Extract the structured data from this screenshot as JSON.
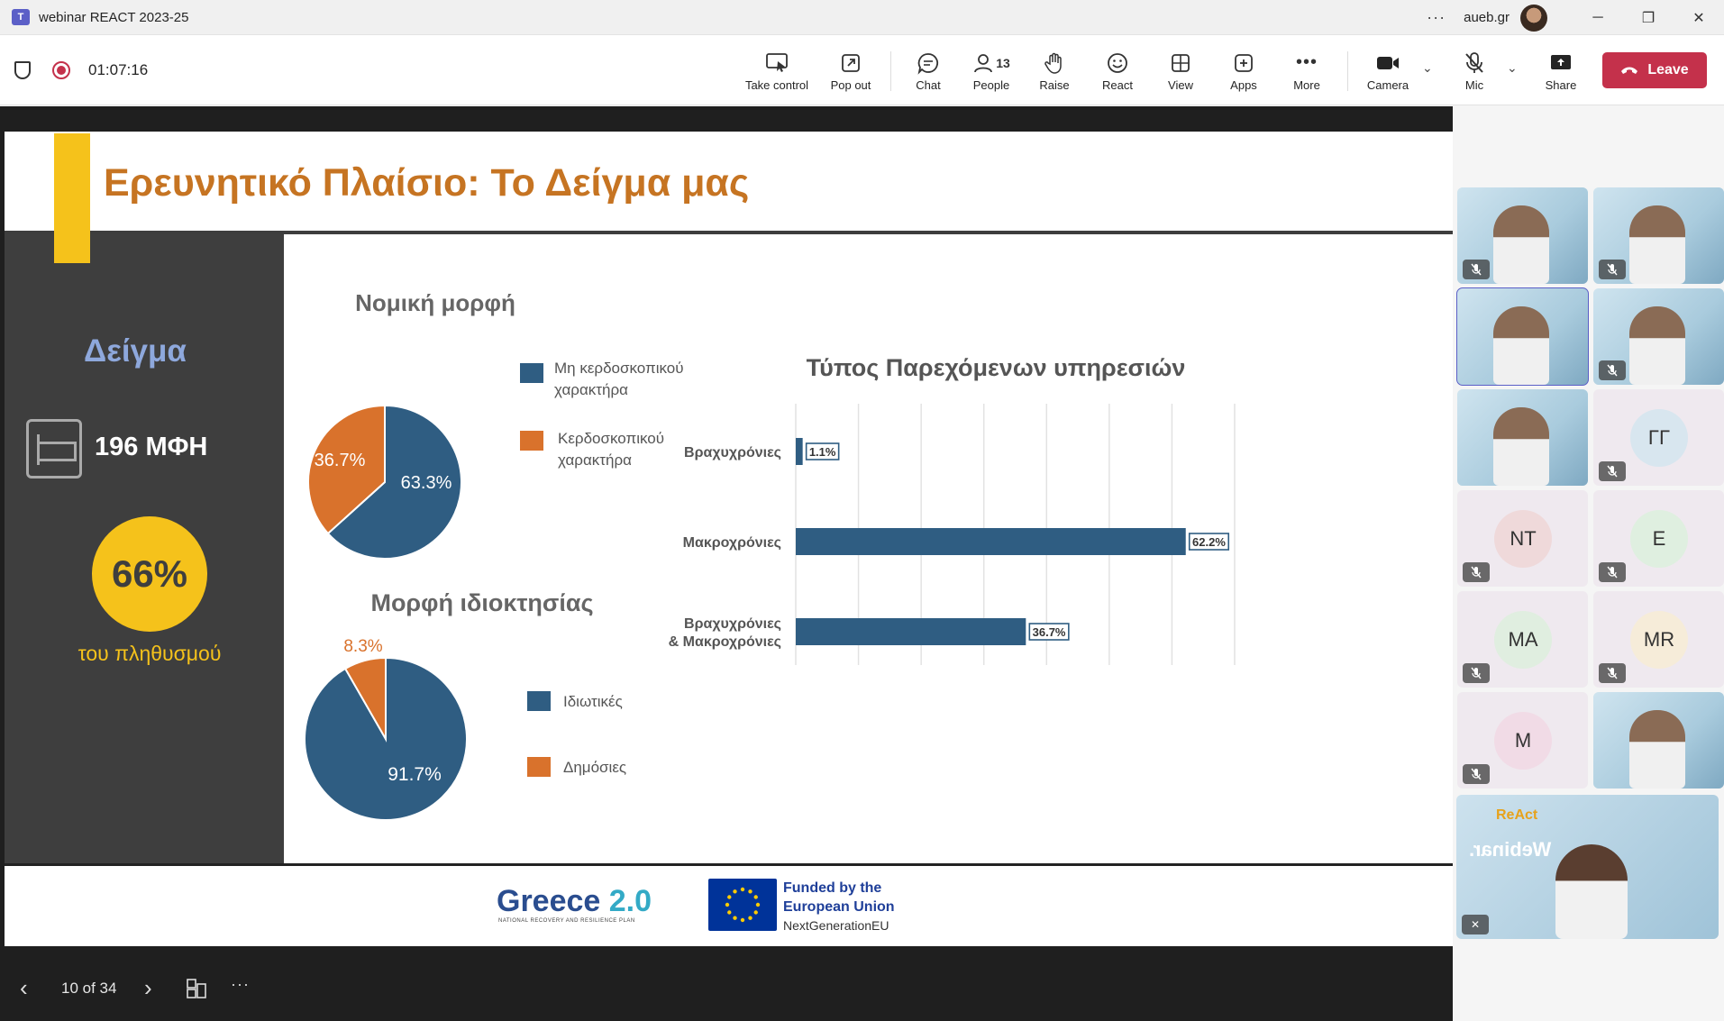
{
  "window": {
    "title": "webinar REACT 2023-25",
    "app_icon": "T",
    "org": "aueb.gr",
    "more": "···",
    "controls": {
      "minimize": "─",
      "restore": "❐",
      "close": "✕"
    }
  },
  "toolbar": {
    "timer": "01:07:16",
    "take_control": "Take control",
    "pop_out": "Pop out",
    "chat": "Chat",
    "people": "People",
    "people_count": "13",
    "raise": "Raise",
    "react": "React",
    "view": "View",
    "apps": "Apps",
    "more": "More",
    "camera": "Camera",
    "mic": "Mic",
    "share": "Share",
    "leave": "Leave",
    "colors": {
      "leave": "#c4314b",
      "accent": "#5b5fc7"
    }
  },
  "slide": {
    "title": "Ερευνητικό Πλαίσιο: Το Δείγμα μας",
    "sample_heading": "Δείγμα",
    "units": "196 ΜΦΗ",
    "percent": "66%",
    "percent_caption": "του πληθυσμού",
    "footer": {
      "greece_main": "Greece ",
      "greece_num": "2.0",
      "greece_sub": "NATIONAL RECOVERY AND RESILIENCE PLAN",
      "funded_line1": "Funded by the",
      "funded_line2": "European Union",
      "nextgen": "NextGenerationEU"
    },
    "colors": {
      "title": "#c67422",
      "yellow": "#f5c21b",
      "heading_blue": "#8ea8dc",
      "blue": "#2f5d82",
      "orange": "#d9722c"
    }
  },
  "chart_data": [
    {
      "type": "pie",
      "title": "Νομική μορφή",
      "series": [
        {
          "name": "Μη κερδοσκοπικού χαρακτήρα",
          "value": 63.3,
          "label": "63.3%",
          "color": "#2f5d82"
        },
        {
          "name": "Κερδοσκοπικού χαρακτήρα",
          "value": 36.7,
          "label": "36.7%",
          "color": "#d9722c"
        }
      ],
      "legend": [
        {
          "line1": "Μη κερδοσκοπικού",
          "line2": "χαρακτήρα"
        },
        {
          "line1": "Κερδοσκοπικού",
          "line2": "χαρακτήρα"
        }
      ]
    },
    {
      "type": "pie",
      "title": "Μορφή ιδιοκτησίας",
      "series": [
        {
          "name": "Ιδιωτικές",
          "value": 91.7,
          "label": "91.7%",
          "color": "#2f5d82"
        },
        {
          "name": "Δημόσιες",
          "value": 8.3,
          "label": "8.3%",
          "color": "#d9722c"
        }
      ]
    },
    {
      "type": "bar",
      "orientation": "horizontal",
      "title": "Τύπος Παρεχόμενων υπηρεσιών",
      "categories": [
        "Βραχυχρόνιες",
        "Μακροχρόνιες",
        "Βραχυχρόνιες & Μακροχρόνιες"
      ],
      "category_lines": [
        [
          "Βραχυχρόνιες"
        ],
        [
          "Μακροχρόνιες"
        ],
        [
          "Βραχυχρόνιες",
          "& Μακροχρόνιες"
        ]
      ],
      "values": [
        1.1,
        62.2,
        36.7
      ],
      "labels": [
        "1.1%",
        "62.2%",
        "36.7%"
      ],
      "xlim": [
        0,
        70
      ],
      "grid": true,
      "color": "#2f5d82"
    }
  ],
  "slidenav": {
    "prev": "‹",
    "next": "›",
    "page": "10 of 34",
    "more": "···"
  },
  "participants": [
    {
      "type": "video",
      "muted": true
    },
    {
      "type": "video",
      "muted": true
    },
    {
      "type": "video",
      "muted": false,
      "active": true
    },
    {
      "type": "video",
      "muted": true
    },
    {
      "type": "video",
      "muted": false
    },
    {
      "type": "avatar",
      "initials": "ΓΓ",
      "color": "#d8e6ef",
      "muted": true
    },
    {
      "type": "avatar",
      "initials": "NT",
      "color": "#efd9da",
      "muted": true
    },
    {
      "type": "avatar",
      "initials": "E",
      "color": "#dfefe0",
      "muted": true
    },
    {
      "type": "avatar",
      "initials": "MA",
      "color": "#e0eee0",
      "muted": true
    },
    {
      "type": "avatar",
      "initials": "MR",
      "color": "#f6ecd9",
      "muted": true
    },
    {
      "type": "avatar",
      "initials": "M",
      "color": "#f1dbe6",
      "muted": true
    },
    {
      "type": "video",
      "muted": false
    }
  ],
  "big_tile": {
    "logo": "ReAct",
    "text": "Webinar."
  }
}
